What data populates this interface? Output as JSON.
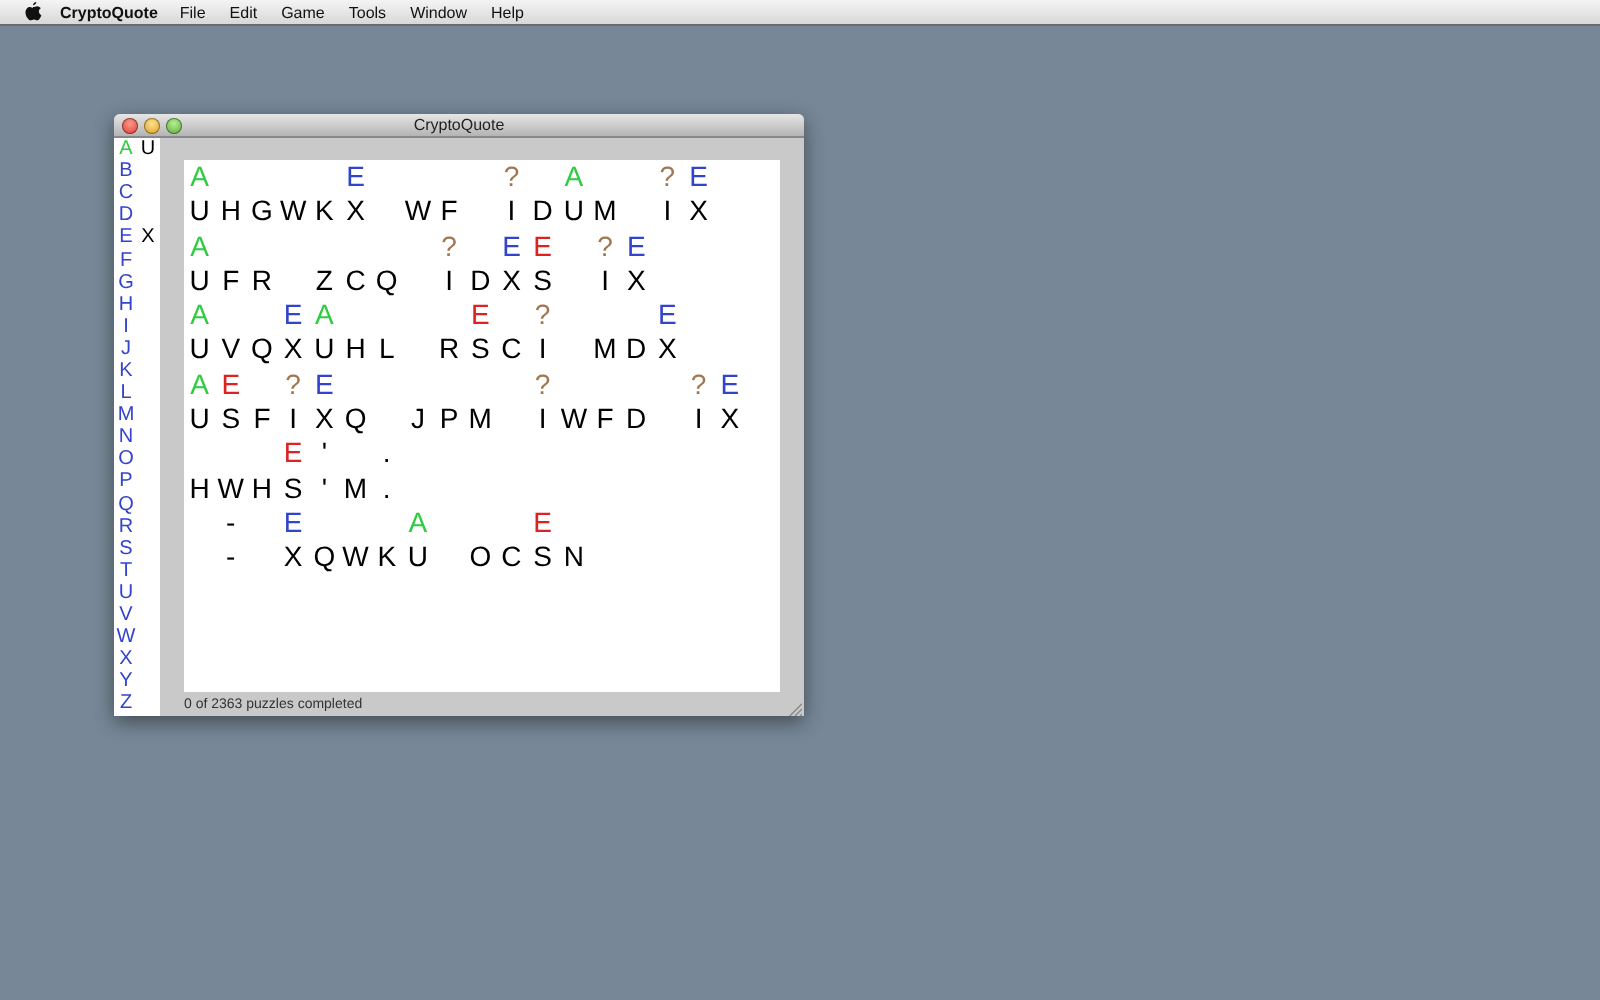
{
  "menu_bar": {
    "app_name": "CryptoQuote",
    "items": [
      "File",
      "Edit",
      "Game",
      "Tools",
      "Window",
      "Help"
    ]
  },
  "window": {
    "title": "CryptoQuote"
  },
  "key_sidebar": [
    {
      "letter": "A",
      "value": "U",
      "selected": true
    },
    {
      "letter": "B",
      "selected": false
    },
    {
      "letter": "C",
      "selected": false
    },
    {
      "letter": "D",
      "selected": false
    },
    {
      "letter": "E",
      "value": "X",
      "selected": false
    },
    {
      "letter": "F",
      "selected": false
    },
    {
      "letter": "G",
      "selected": false
    },
    {
      "letter": "H",
      "selected": false
    },
    {
      "letter": "I",
      "selected": false
    },
    {
      "letter": "J",
      "selected": false
    },
    {
      "letter": "K",
      "selected": false
    },
    {
      "letter": "L",
      "selected": false
    },
    {
      "letter": "M",
      "selected": false
    },
    {
      "letter": "N",
      "selected": false
    },
    {
      "letter": "O",
      "selected": false
    },
    {
      "letter": "P",
      "selected": false
    },
    {
      "letter": "Q",
      "selected": false
    },
    {
      "letter": "R",
      "selected": false
    },
    {
      "letter": "S",
      "selected": false
    },
    {
      "letter": "T",
      "selected": false
    },
    {
      "letter": "U",
      "selected": false
    },
    {
      "letter": "V",
      "selected": false
    },
    {
      "letter": "W",
      "selected": false
    },
    {
      "letter": "X",
      "selected": false
    },
    {
      "letter": "Y",
      "selected": false
    },
    {
      "letter": "Z",
      "selected": false
    }
  ],
  "puzzle_lines": [
    {
      "cells": [
        {
          "kind": "letter",
          "cipher": "U",
          "guess": "A",
          "color": "#2ecc40"
        },
        {
          "kind": "letter",
          "cipher": "H"
        },
        {
          "kind": "letter",
          "cipher": "G"
        },
        {
          "kind": "letter",
          "cipher": "W"
        },
        {
          "kind": "letter",
          "cipher": "K"
        },
        {
          "kind": "letter",
          "cipher": "X",
          "guess": "E",
          "color": "#3344cc"
        },
        {
          "kind": "gap"
        },
        {
          "kind": "letter",
          "cipher": "W"
        },
        {
          "kind": "letter",
          "cipher": "F"
        },
        {
          "kind": "gap"
        },
        {
          "kind": "letter",
          "cipher": "I",
          "guess": "?",
          "color": "#a07850"
        },
        {
          "kind": "letter",
          "cipher": "D"
        },
        {
          "kind": "letter",
          "cipher": "U",
          "guess": "A",
          "color": "#2ecc40"
        },
        {
          "kind": "letter",
          "cipher": "M"
        },
        {
          "kind": "gap"
        },
        {
          "kind": "letter",
          "cipher": "I",
          "guess": "?",
          "color": "#a07850"
        },
        {
          "kind": "letter",
          "cipher": "X",
          "guess": "E",
          "color": "#3344cc"
        }
      ]
    },
    {
      "cells": [
        {
          "kind": "letter",
          "cipher": "U",
          "guess": "A",
          "color": "#2ecc40"
        },
        {
          "kind": "letter",
          "cipher": "F"
        },
        {
          "kind": "letter",
          "cipher": "R"
        },
        {
          "kind": "gap"
        },
        {
          "kind": "letter",
          "cipher": "Z"
        },
        {
          "kind": "letter",
          "cipher": "C"
        },
        {
          "kind": "letter",
          "cipher": "Q"
        },
        {
          "kind": "gap"
        },
        {
          "kind": "letter",
          "cipher": "I",
          "guess": "?",
          "color": "#a07850"
        },
        {
          "kind": "letter",
          "cipher": "D"
        },
        {
          "kind": "letter",
          "cipher": "X",
          "guess": "E",
          "color": "#3344cc"
        },
        {
          "kind": "letter",
          "cipher": "S",
          "guess": "E",
          "color": "#dd2222"
        },
        {
          "kind": "gap"
        },
        {
          "kind": "letter",
          "cipher": "I",
          "guess": "?",
          "color": "#a07850"
        },
        {
          "kind": "letter",
          "cipher": "X",
          "guess": "E",
          "color": "#3344cc"
        }
      ]
    },
    {
      "cells": [
        {
          "kind": "letter",
          "cipher": "U",
          "guess": "A",
          "color": "#2ecc40"
        },
        {
          "kind": "letter",
          "cipher": "V"
        },
        {
          "kind": "letter",
          "cipher": "Q"
        },
        {
          "kind": "letter",
          "cipher": "X",
          "guess": "E",
          "color": "#3344cc"
        },
        {
          "kind": "letter",
          "cipher": "U",
          "guess": "A",
          "color": "#2ecc40"
        },
        {
          "kind": "letter",
          "cipher": "H"
        },
        {
          "kind": "letter",
          "cipher": "L"
        },
        {
          "kind": "gap"
        },
        {
          "kind": "letter",
          "cipher": "R"
        },
        {
          "kind": "letter",
          "cipher": "S",
          "guess": "E",
          "color": "#dd2222"
        },
        {
          "kind": "letter",
          "cipher": "C"
        },
        {
          "kind": "letter",
          "cipher": "I",
          "guess": "?",
          "color": "#a07850"
        },
        {
          "kind": "gap"
        },
        {
          "kind": "letter",
          "cipher": "M"
        },
        {
          "kind": "letter",
          "cipher": "D"
        },
        {
          "kind": "letter",
          "cipher": "X",
          "guess": "E",
          "color": "#3344cc"
        }
      ]
    },
    {
      "cells": [
        {
          "kind": "letter",
          "cipher": "U",
          "guess": "A",
          "color": "#2ecc40"
        },
        {
          "kind": "letter",
          "cipher": "S",
          "guess": "E",
          "color": "#dd2222"
        },
        {
          "kind": "letter",
          "cipher": "F"
        },
        {
          "kind": "letter",
          "cipher": "I",
          "guess": "?",
          "color": "#a07850"
        },
        {
          "kind": "letter",
          "cipher": "X",
          "guess": "E",
          "color": "#3344cc"
        },
        {
          "kind": "letter",
          "cipher": "Q"
        },
        {
          "kind": "gap"
        },
        {
          "kind": "letter",
          "cipher": "J"
        },
        {
          "kind": "letter",
          "cipher": "P"
        },
        {
          "kind": "letter",
          "cipher": "M"
        },
        {
          "kind": "gap"
        },
        {
          "kind": "letter",
          "cipher": "I",
          "guess": "?",
          "color": "#a07850"
        },
        {
          "kind": "letter",
          "cipher": "W"
        },
        {
          "kind": "letter",
          "cipher": "F"
        },
        {
          "kind": "letter",
          "cipher": "D"
        },
        {
          "kind": "gap"
        },
        {
          "kind": "letter",
          "cipher": "I",
          "guess": "?",
          "color": "#a07850"
        },
        {
          "kind": "letter",
          "cipher": "X",
          "guess": "E",
          "color": "#3344cc"
        }
      ]
    },
    {
      "cells": [
        {
          "kind": "letter",
          "cipher": "H"
        },
        {
          "kind": "letter",
          "cipher": "W"
        },
        {
          "kind": "letter",
          "cipher": "H"
        },
        {
          "kind": "letter",
          "cipher": "S",
          "guess": "E",
          "color": "#dd2222"
        },
        {
          "kind": "letter",
          "cipher": "'",
          "guess": "'",
          "color": "#000000"
        },
        {
          "kind": "letter",
          "cipher": "M"
        },
        {
          "kind": "letter",
          "cipher": ".",
          "guess": ".",
          "color": "#000000"
        }
      ]
    },
    {
      "cells": [
        {
          "kind": "gap"
        },
        {
          "kind": "letter",
          "cipher": "-",
          "guess": "-",
          "color": "#000000"
        },
        {
          "kind": "gap"
        },
        {
          "kind": "letter",
          "cipher": "X",
          "guess": "E",
          "color": "#3344cc"
        },
        {
          "kind": "letter",
          "cipher": "Q"
        },
        {
          "kind": "letter",
          "cipher": "W"
        },
        {
          "kind": "letter",
          "cipher": "K"
        },
        {
          "kind": "letter",
          "cipher": "U",
          "guess": "A",
          "color": "#2ecc40"
        },
        {
          "kind": "gap"
        },
        {
          "kind": "letter",
          "cipher": "O"
        },
        {
          "kind": "letter",
          "cipher": "C"
        },
        {
          "kind": "letter",
          "cipher": "S",
          "guess": "E",
          "color": "#dd2222"
        },
        {
          "kind": "letter",
          "cipher": "N"
        }
      ]
    }
  ],
  "status_bar": "0 of 2363 puzzles completed"
}
